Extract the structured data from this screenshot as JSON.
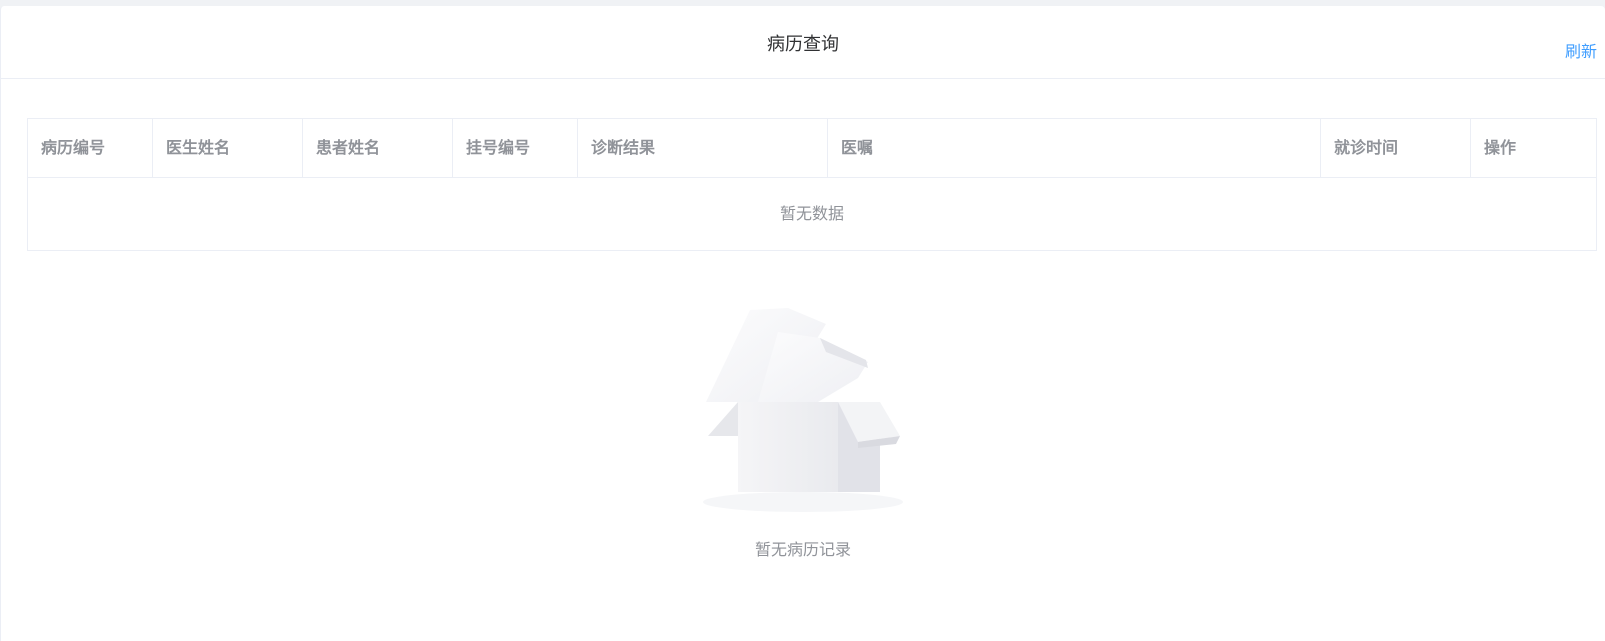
{
  "header": {
    "title": "病历查询",
    "refresh_label": "刷新"
  },
  "table": {
    "columns": [
      "病历编号",
      "医生姓名",
      "患者姓名",
      "挂号编号",
      "诊断结果",
      "医嘱",
      "就诊时间",
      "操作"
    ],
    "empty_text": "暂无数据"
  },
  "empty_state": {
    "icon": "empty-box-icon",
    "description": "暂无病历记录"
  },
  "colors": {
    "accent": "#409eff",
    "header_text": "#909399",
    "title_text": "#303133",
    "border": "#ebeef5"
  }
}
